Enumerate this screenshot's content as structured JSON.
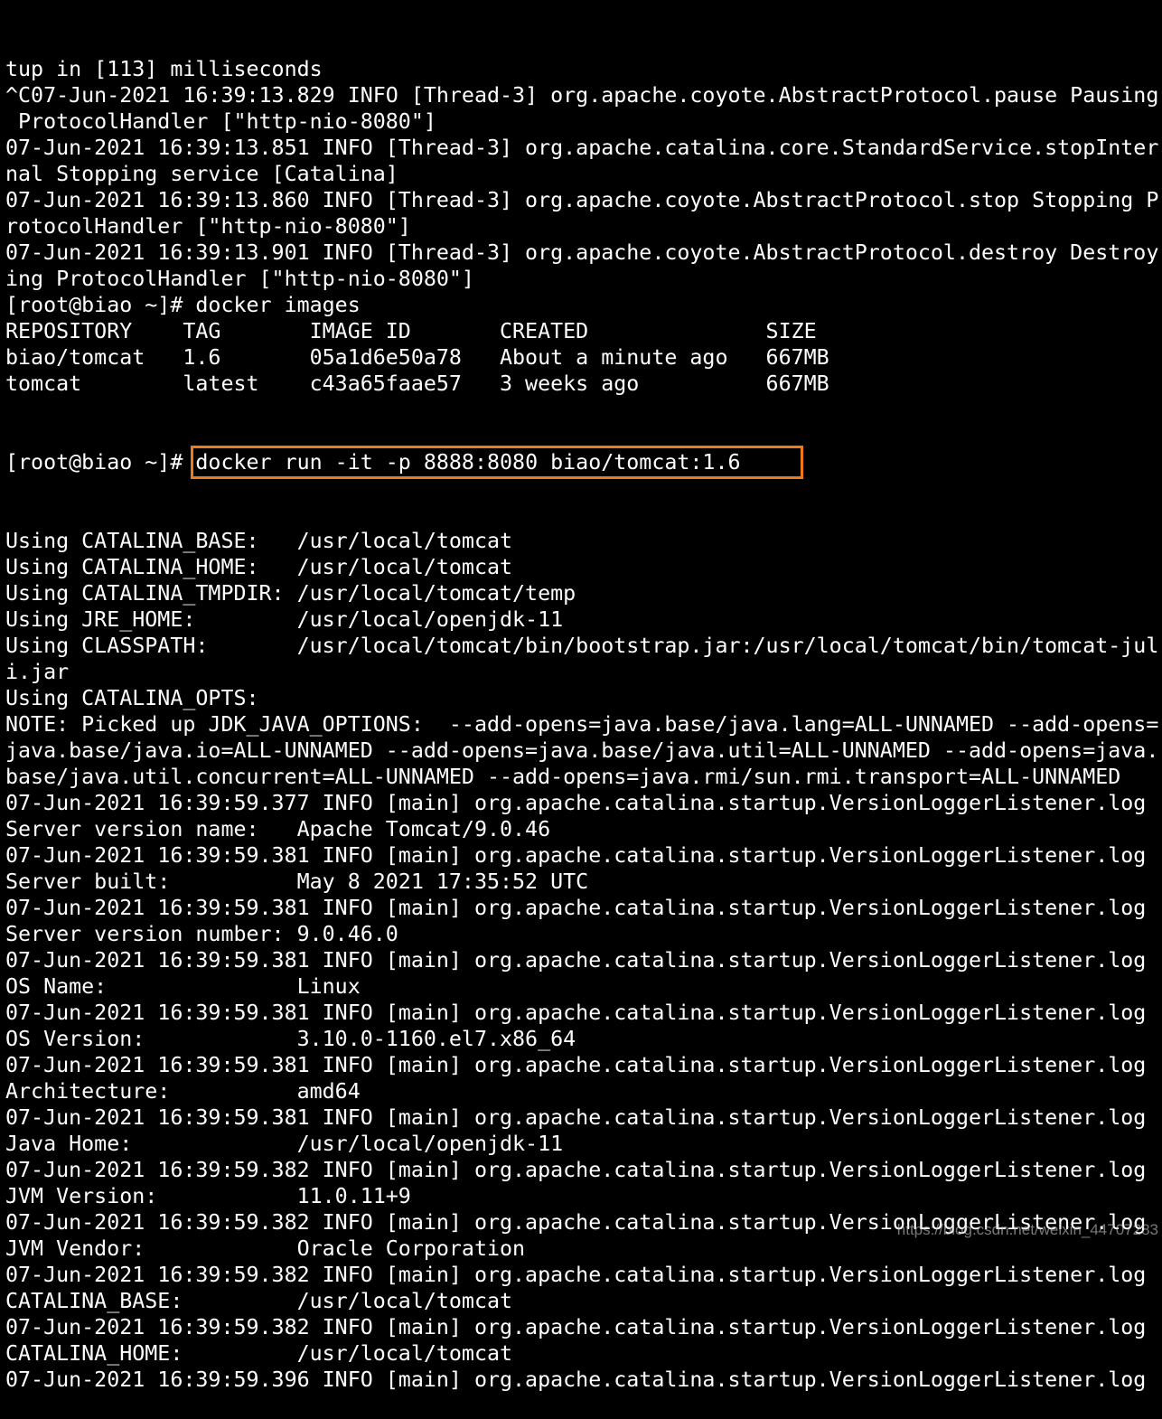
{
  "terminal": {
    "lines": [
      "tup in [113] milliseconds",
      "^C07-Jun-2021 16:39:13.829 INFO [Thread-3] org.apache.coyote.AbstractProtocol.pause Pausing",
      " ProtocolHandler [\"http-nio-8080\"]",
      "07-Jun-2021 16:39:13.851 INFO [Thread-3] org.apache.catalina.core.StandardService.stopInter",
      "nal Stopping service [Catalina]",
      "07-Jun-2021 16:39:13.860 INFO [Thread-3] org.apache.coyote.AbstractProtocol.stop Stopping P",
      "rotocolHandler [\"http-nio-8080\"]",
      "07-Jun-2021 16:39:13.901 INFO [Thread-3] org.apache.coyote.AbstractProtocol.destroy Destroy",
      "ing ProtocolHandler [\"http-nio-8080\"]",
      "[root@biao ~]# docker images",
      "REPOSITORY    TAG       IMAGE ID       CREATED              SIZE",
      "biao/tomcat   1.6       05a1d6e50a78   About a minute ago   667MB",
      "tomcat        latest    c43a65faae57   3 weeks ago          667MB"
    ],
    "prompt": "[root@biao ~]# ",
    "highlighted_command": "docker run -it -p 8888:8080 biao/tomcat:1.6",
    "lines_after": [
      "Using CATALINA_BASE:   /usr/local/tomcat",
      "Using CATALINA_HOME:   /usr/local/tomcat",
      "Using CATALINA_TMPDIR: /usr/local/tomcat/temp",
      "Using JRE_HOME:        /usr/local/openjdk-11",
      "Using CLASSPATH:       /usr/local/tomcat/bin/bootstrap.jar:/usr/local/tomcat/bin/tomcat-jul",
      "i.jar",
      "Using CATALINA_OPTS:",
      "NOTE: Picked up JDK_JAVA_OPTIONS:  --add-opens=java.base/java.lang=ALL-UNNAMED --add-opens=",
      "java.base/java.io=ALL-UNNAMED --add-opens=java.base/java.util=ALL-UNNAMED --add-opens=java.",
      "base/java.util.concurrent=ALL-UNNAMED --add-opens=java.rmi/sun.rmi.transport=ALL-UNNAMED",
      "07-Jun-2021 16:39:59.377 INFO [main] org.apache.catalina.startup.VersionLoggerListener.log",
      "Server version name:   Apache Tomcat/9.0.46",
      "07-Jun-2021 16:39:59.381 INFO [main] org.apache.catalina.startup.VersionLoggerListener.log",
      "Server built:          May 8 2021 17:35:52 UTC",
      "07-Jun-2021 16:39:59.381 INFO [main] org.apache.catalina.startup.VersionLoggerListener.log",
      "Server version number: 9.0.46.0",
      "07-Jun-2021 16:39:59.381 INFO [main] org.apache.catalina.startup.VersionLoggerListener.log",
      "OS Name:               Linux",
      "07-Jun-2021 16:39:59.381 INFO [main] org.apache.catalina.startup.VersionLoggerListener.log",
      "OS Version:            3.10.0-1160.el7.x86_64",
      "07-Jun-2021 16:39:59.381 INFO [main] org.apache.catalina.startup.VersionLoggerListener.log",
      "Architecture:          amd64",
      "07-Jun-2021 16:39:59.381 INFO [main] org.apache.catalina.startup.VersionLoggerListener.log",
      "Java Home:             /usr/local/openjdk-11",
      "07-Jun-2021 16:39:59.382 INFO [main] org.apache.catalina.startup.VersionLoggerListener.log",
      "JVM Version:           11.0.11+9",
      "07-Jun-2021 16:39:59.382 INFO [main] org.apache.catalina.startup.VersionLoggerListener.log",
      "JVM Vendor:            Oracle Corporation",
      "07-Jun-2021 16:39:59.382 INFO [main] org.apache.catalina.startup.VersionLoggerListener.log",
      "CATALINA_BASE:         /usr/local/tomcat",
      "07-Jun-2021 16:39:59.382 INFO [main] org.apache.catalina.startup.VersionLoggerListener.log",
      "CATALINA_HOME:         /usr/local/tomcat",
      "07-Jun-2021 16:39:59.396 INFO [main] org.apache.catalina.startup.VersionLoggerListener.log"
    ],
    "highlight_color": "#f07a1a"
  },
  "watermark": "https://blog.csdn.net/weixin_44707283"
}
